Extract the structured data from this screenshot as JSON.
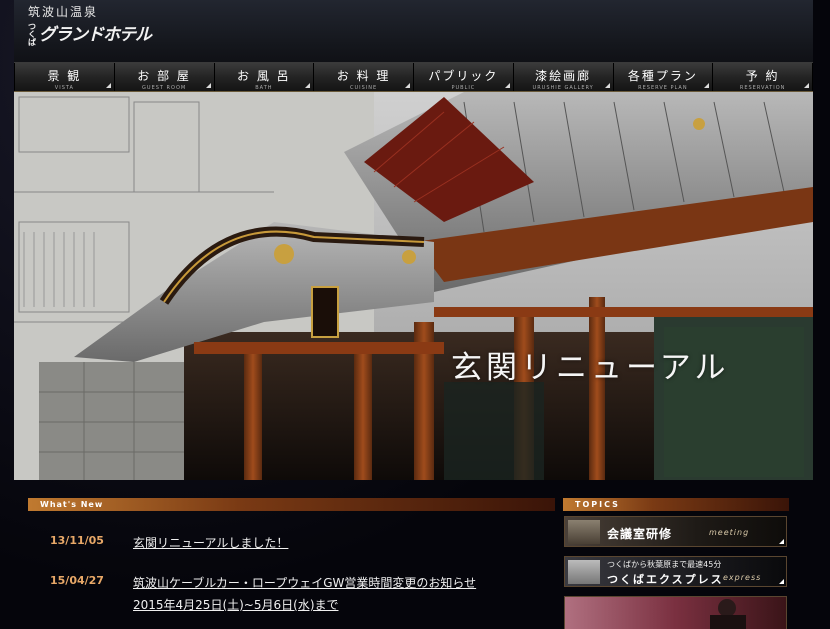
{
  "header": {
    "logo_top": "筑波山温泉",
    "logo_small": "つくば",
    "logo_main": "グランドホテル"
  },
  "nav": [
    {
      "jp": "景 観",
      "en": "VISTA"
    },
    {
      "jp": "お 部 屋",
      "en": "GUEST ROOM"
    },
    {
      "jp": "お 風 呂",
      "en": "BATH"
    },
    {
      "jp": "お 料 理",
      "en": "CUISINE"
    },
    {
      "jp": "パブリック",
      "en": "PUBLIC"
    },
    {
      "jp": "漆絵画廊",
      "en": "URUSHIE GALLERY"
    },
    {
      "jp": "各種プラン",
      "en": "RESERVE PLAN"
    },
    {
      "jp": "予 約",
      "en": "RESERVATION"
    }
  ],
  "hero": {
    "caption": "玄関リニューアル"
  },
  "news": {
    "label": "What's New",
    "items": [
      {
        "date": "13/11/05",
        "text": "玄関リニューアルしました！"
      },
      {
        "date": "15/04/27",
        "text": "筑波山ケーブルカー・ロープウェイGW営業時間変更のお知らせ",
        "text2": "2015年4月25日(土)~5月6日(水)まで"
      }
    ]
  },
  "topics": {
    "label": "TOPICS",
    "meeting": {
      "jp": "会議室研修",
      "en": "meeting"
    },
    "express": {
      "small": "つくばから秋葉原まで最速45分",
      "big": "つくばエクスプレス",
      "en": "express"
    }
  },
  "colors": {
    "accent": "#c07a30",
    "date": "#e8a868",
    "background": "#0a0a14"
  }
}
